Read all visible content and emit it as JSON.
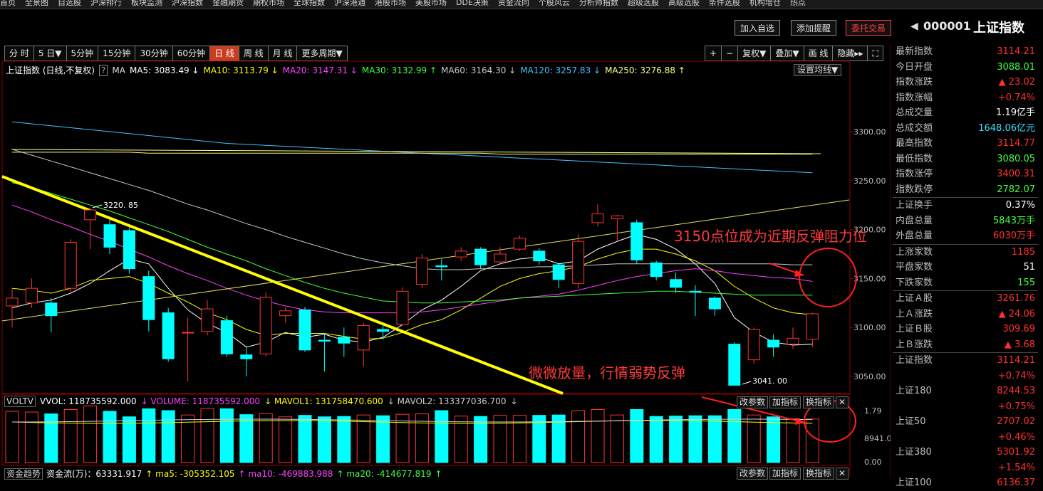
{
  "topnav": [
    "首页",
    "全景图",
    "自选股",
    "沪深排行",
    "板块监测",
    "沪深指数",
    "金融期货",
    "期权市场",
    "全球指数",
    "沪深港通",
    "港股市场",
    "美股市场",
    "DDE决策",
    "资金流向",
    "个股风云",
    "分析师指数",
    "超级选股",
    "高级选股",
    "条件选股",
    "机构增仓",
    "热点"
  ],
  "toolbar": {
    "add_watch": "加入自选",
    "add_alert": "添加提醒",
    "trade": "委托交易"
  },
  "title": {
    "code": "000001",
    "name": "上证指数"
  },
  "periods": [
    "分 时",
    "5 日▼",
    "5分钟",
    "15分钟",
    "30分钟",
    "60分钟",
    "日 线",
    "周 线",
    "月 线",
    "更多周期▼"
  ],
  "active_period": "日 线",
  "tools_right": [
    "+",
    "−",
    "复权▼",
    "叠加▼",
    "画 线",
    "隐藏▸▸",
    "⛶"
  ],
  "ma_legend": {
    "name": "上证指数 (日线,不复权)",
    "items": [
      {
        "text": "MA5: 3083.49 ↓",
        "color": "#ffffff"
      },
      {
        "text": "MA10: 3113.79 ↓",
        "color": "#ffff00"
      },
      {
        "text": "MA20: 3147.31 ↓",
        "color": "#ff40ff"
      },
      {
        "text": "MA30: 3132.99 ↑",
        "color": "#40ff40"
      },
      {
        "text": "MA60: 3164.30 ↓",
        "color": "#c8c8c8"
      },
      {
        "text": "MA120: 3257.83 ↓",
        "color": "#40c0ff"
      },
      {
        "text": "MA250: 3276.88 ↑",
        "color": "#ffff80"
      }
    ],
    "setting": "设置均线▼"
  },
  "annotations": {
    "resistance": "3150点位成为近期反弹阻力位",
    "volume": "微微放量，行情弱势反弹",
    "high_label": "3220. 85",
    "low_label": "3041. 00"
  },
  "price_axis": [
    "3300.00",
    "3250.00",
    "3200.00",
    "3150.00",
    "3100.00",
    "3050.00"
  ],
  "vol_axis": [
    "1.79",
    "8941.00",
    "0.00"
  ],
  "right_panel": [
    {
      "label": "最新指数",
      "value": "3114.21",
      "color": "#ff3030"
    },
    {
      "label": "今日开盘",
      "value": "3088.01",
      "color": "#40ff40"
    },
    {
      "label": "指数涨跌",
      "value": "▲ 23.02",
      "color": "#ff3030"
    },
    {
      "label": "指数涨幅",
      "value": "+0.74%",
      "color": "#ff3030"
    },
    {
      "label": "总成交量",
      "value": "1.19亿手",
      "color": "#ffffff"
    },
    {
      "label": "总成交额",
      "value": "1648.06亿元",
      "color": "#40e0ff"
    },
    {
      "label": "最高指数",
      "value": "3114.77",
      "color": "#ff3030"
    },
    {
      "label": "最低指数",
      "value": "3080.05",
      "color": "#40ff40"
    },
    {
      "label": "指数涨停",
      "value": "3400.31",
      "color": "#ff3030"
    },
    {
      "label": "指数跌停",
      "value": "2782.07",
      "color": "#40ff40"
    },
    {
      "label": "上证换手",
      "value": "0.37%",
      "color": "#ffffff",
      "sep": true
    },
    {
      "label": "内盘总量",
      "value": "5843万手",
      "color": "#40ff40"
    },
    {
      "label": "外盘总量",
      "value": "6030万手",
      "color": "#ff3030"
    },
    {
      "label": "上涨家数",
      "value": "1185",
      "color": "#ff3030",
      "sep": true
    },
    {
      "label": "平盘家数",
      "value": "51",
      "color": "#ffffff"
    },
    {
      "label": "下跌家数",
      "value": "155",
      "color": "#40ff40"
    },
    {
      "label": "上证Ａ股",
      "value": "3261.76",
      "color": "#ff3030",
      "sep": true
    },
    {
      "label": "上Ａ涨跌",
      "value": "▲ 24.06",
      "color": "#ff3030"
    },
    {
      "label": "上证Ｂ股",
      "value": "309.69",
      "color": "#ff3030"
    },
    {
      "label": "上Ｂ涨跌",
      "value": "▲ 3.68",
      "color": "#ff3030"
    },
    {
      "label": "上证指数",
      "value": "3114.21",
      "color": "#ff3030",
      "sep": true
    },
    {
      "label": "",
      "value": "+0.74%",
      "color": "#ff3030"
    },
    {
      "label": "上证180",
      "value": "8244.53",
      "color": "#ff3030"
    },
    {
      "label": "",
      "value": "+0.75%",
      "color": "#ff3030"
    },
    {
      "label": "上证50",
      "value": "2707.02",
      "color": "#ff3030"
    },
    {
      "label": "",
      "value": "+0.46%",
      "color": "#ff3030"
    },
    {
      "label": "上证380",
      "value": "5301.92",
      "color": "#ff3030"
    },
    {
      "label": "",
      "value": "+1.54%",
      "color": "#ff3030"
    },
    {
      "label": "上证100",
      "value": "6136.37",
      "color": "#ff3030"
    }
  ],
  "vol_legend": {
    "name": "VOLTV",
    "items": [
      {
        "text": "VVOL: 118735592.000",
        "color": "#ffffff"
      },
      {
        "text": "↓ VOLUME: 118735592.000",
        "color": "#ff40ff"
      },
      {
        "text": "↓ MAVOL1: 131758470.600",
        "color": "#ffff00"
      },
      {
        "text": "↓ MAVOL2: 133377036.700",
        "color": "#d0d0d0"
      },
      {
        "text": "↓",
        "color": "#d0d0d0"
      }
    ]
  },
  "indicator_btns": [
    "改参数",
    "加指标",
    "换指标",
    "✕"
  ],
  "flow_legend": {
    "name": "资金趋势",
    "items": [
      {
        "text": "资金流(万)：63331.917",
        "color": "#ffffff"
      },
      {
        "text": "↑ ma5: -305352.105",
        "color": "#ffff00"
      },
      {
        "text": "↑ ma10: -469883.988",
        "color": "#ff40ff"
      },
      {
        "text": "↑ ma20: -414677.819",
        "color": "#40ff40"
      },
      {
        "text": "↑",
        "color": "#40ff40"
      }
    ]
  },
  "chart_data": {
    "type": "candlestick",
    "ylim": [
      3030,
      3340
    ],
    "candles": [
      {
        "o": 3122,
        "c": 3130,
        "h": 3140,
        "l": 3100
      },
      {
        "o": 3125,
        "c": 3140,
        "h": 3150,
        "l": 3120
      },
      {
        "o": 3125,
        "c": 3112,
        "h": 3130,
        "l": 3095
      },
      {
        "o": 3140,
        "c": 3187,
        "h": 3190,
        "l": 3135
      },
      {
        "o": 3210,
        "c": 3220,
        "h": 3221,
        "l": 3180
      },
      {
        "o": 3205,
        "c": 3182,
        "h": 3210,
        "l": 3175
      },
      {
        "o": 3199,
        "c": 3160,
        "h": 3202,
        "l": 3155
      },
      {
        "o": 3152,
        "c": 3108,
        "h": 3158,
        "l": 3096
      },
      {
        "o": 3115,
        "c": 3068,
        "h": 3120,
        "l": 3065
      },
      {
        "o": 3095,
        "c": 3095,
        "h": 3110,
        "l": 3045
      },
      {
        "o": 3096,
        "c": 3119,
        "h": 3128,
        "l": 3092
      },
      {
        "o": 3107,
        "c": 3073,
        "h": 3112,
        "l": 3070
      },
      {
        "o": 3072,
        "c": 3068,
        "h": 3081,
        "l": 3050
      },
      {
        "o": 3073,
        "c": 3131,
        "h": 3136,
        "l": 3070
      },
      {
        "o": 3112,
        "c": 3117,
        "h": 3120,
        "l": 3105
      },
      {
        "o": 3118,
        "c": 3077,
        "h": 3121,
        "l": 3075
      },
      {
        "o": 3087,
        "c": 3086,
        "h": 3094,
        "l": 3055
      },
      {
        "o": 3090,
        "c": 3084,
        "h": 3100,
        "l": 3070
      },
      {
        "o": 3077,
        "c": 3102,
        "h": 3105,
        "l": 3060
      },
      {
        "o": 3098,
        "c": 3096,
        "h": 3103,
        "l": 3088
      },
      {
        "o": 3103,
        "c": 3137,
        "h": 3141,
        "l": 3102
      },
      {
        "o": 3144,
        "c": 3171,
        "h": 3175,
        "l": 3140
      },
      {
        "o": 3163,
        "c": 3162,
        "h": 3170,
        "l": 3148
      },
      {
        "o": 3172,
        "c": 3178,
        "h": 3182,
        "l": 3168
      },
      {
        "o": 3180,
        "c": 3164,
        "h": 3182,
        "l": 3160
      },
      {
        "o": 3167,
        "c": 3175,
        "h": 3182,
        "l": 3165
      },
      {
        "o": 3180,
        "c": 3191,
        "h": 3194,
        "l": 3178
      },
      {
        "o": 3178,
        "c": 3168,
        "h": 3181,
        "l": 3164
      },
      {
        "o": 3164,
        "c": 3149,
        "h": 3166,
        "l": 3140
      },
      {
        "o": 3145,
        "c": 3188,
        "h": 3195,
        "l": 3140
      },
      {
        "o": 3207,
        "c": 3216,
        "h": 3226,
        "l": 3203
      },
      {
        "o": 3211,
        "c": 3214,
        "h": 3215,
        "l": 3188
      },
      {
        "o": 3207,
        "c": 3169,
        "h": 3210,
        "l": 3165
      },
      {
        "o": 3166,
        "c": 3152,
        "h": 3168,
        "l": 3148
      },
      {
        "o": 3149,
        "c": 3141,
        "h": 3156,
        "l": 3135
      },
      {
        "o": 3137,
        "c": 3136,
        "h": 3143,
        "l": 3112
      },
      {
        "o": 3130,
        "c": 3119,
        "h": 3132,
        "l": 3112
      },
      {
        "o": 3083,
        "c": 3041,
        "h": 3085,
        "l": 3041
      },
      {
        "o": 3067,
        "c": 3098,
        "h": 3100,
        "l": 3063
      },
      {
        "o": 3087,
        "c": 3080,
        "h": 3093,
        "l": 3070
      },
      {
        "o": 3083,
        "c": 3089,
        "h": 3100,
        "l": 3078
      },
      {
        "o": 3088,
        "c": 3114,
        "h": 3115,
        "l": 3080
      }
    ],
    "volume_ylim": [
      0,
      1.79
    ],
    "volumes": [
      1.4,
      1.38,
      1.33,
      1.45,
      1.55,
      1.4,
      1.25,
      1.47,
      1.42,
      1.3,
      1.48,
      1.47,
      1.31,
      1.34,
      1.25,
      1.29,
      1.25,
      1.26,
      1.3,
      1.28,
      1.32,
      1.33,
      1.42,
      1.27,
      1.26,
      1.29,
      1.29,
      1.29,
      1.3,
      1.42,
      1.45,
      1.3,
      1.45,
      1.26,
      1.27,
      1.28,
      1.28,
      1.45,
      1.3,
      1.25,
      1.2,
      1.19
    ],
    "ma_lines": [
      {
        "name": "MA5",
        "color": "#ffffff",
        "values": [
          3120,
          3125,
          3128,
          3135,
          3145,
          3158,
          3170,
          3165,
          3140,
          3118,
          3104,
          3095,
          3080,
          3085,
          3095,
          3090,
          3093,
          3087,
          3085,
          3090,
          3103,
          3118,
          3128,
          3142,
          3158,
          3165,
          3170,
          3172,
          3165,
          3168,
          3180,
          3188,
          3195,
          3190,
          3180,
          3165,
          3145,
          3110,
          3095,
          3085,
          3082,
          3083
        ]
      },
      {
        "name": "MA10",
        "color": "#ffff00",
        "values": [
          3140,
          3138,
          3135,
          3140,
          3148,
          3150,
          3152,
          3145,
          3135,
          3126,
          3115,
          3108,
          3098,
          3092,
          3094,
          3094,
          3094,
          3091,
          3088,
          3089,
          3095,
          3103,
          3108,
          3118,
          3130,
          3142,
          3150,
          3155,
          3158,
          3162,
          3170,
          3176,
          3180,
          3180,
          3175,
          3168,
          3158,
          3142,
          3130,
          3120,
          3115,
          3113
        ]
      },
      {
        "name": "MA20",
        "color": "#ff40ff",
        "values": [
          3225,
          3218,
          3210,
          3203,
          3195,
          3188,
          3180,
          3172,
          3163,
          3155,
          3148,
          3140,
          3133,
          3127,
          3122,
          3118,
          3116,
          3115,
          3115,
          3115,
          3115,
          3116,
          3118,
          3121,
          3124,
          3127,
          3130,
          3132,
          3134,
          3138,
          3143,
          3148,
          3152,
          3155,
          3158,
          3160,
          3158,
          3155,
          3153,
          3151,
          3150,
          3147
        ]
      },
      {
        "name": "MA30",
        "color": "#40ff40",
        "values": [
          3248,
          3243,
          3237,
          3231,
          3225,
          3219,
          3212,
          3205,
          3198,
          3190,
          3182,
          3175,
          3168,
          3160,
          3153,
          3146,
          3140,
          3135,
          3131,
          3127,
          3126,
          3125,
          3125,
          3126,
          3127,
          3128,
          3130,
          3131,
          3132,
          3133,
          3134,
          3135,
          3136,
          3137,
          3137,
          3136,
          3135,
          3134,
          3133,
          3133,
          3133,
          3133
        ]
      },
      {
        "name": "MA60",
        "color": "#c8c8c8",
        "values": [
          3282,
          3276,
          3270,
          3264,
          3258,
          3252,
          3246,
          3240,
          3233,
          3226,
          3220,
          3213,
          3206,
          3200,
          3193,
          3187,
          3181,
          3175,
          3170,
          3166,
          3163,
          3160,
          3159,
          3159,
          3160,
          3160,
          3161,
          3162,
          3162,
          3163,
          3164,
          3165,
          3165,
          3165,
          3165,
          3165,
          3165,
          3165,
          3165,
          3165,
          3164,
          3164
        ]
      },
      {
        "name": "MA120",
        "color": "#40c0ff",
        "values": [
          3310,
          3308,
          3306,
          3304,
          3302,
          3300,
          3298,
          3296,
          3294,
          3292,
          3290,
          3288,
          3287,
          3286,
          3285,
          3284,
          3283,
          3282,
          3281,
          3280,
          3279,
          3278,
          3277,
          3276,
          3275,
          3274,
          3273,
          3272,
          3271,
          3270,
          3269,
          3268,
          3267,
          3266,
          3265,
          3264,
          3263,
          3262,
          3261,
          3260,
          3259,
          3258
        ]
      },
      {
        "name": "MA250",
        "color": "#ffff80",
        "values": [
          3279,
          3279,
          3279,
          3279,
          3279,
          3279,
          3279,
          3278,
          3278,
          3278,
          3278,
          3278,
          3278,
          3278,
          3278,
          3278,
          3278,
          3278,
          3278,
          3278,
          3278,
          3278,
          3278,
          3278,
          3278,
          3277,
          3277,
          3277,
          3277,
          3277,
          3277,
          3277,
          3277,
          3277,
          3277,
          3277,
          3277,
          3277,
          3277,
          3277,
          3277,
          3277
        ]
      }
    ]
  }
}
